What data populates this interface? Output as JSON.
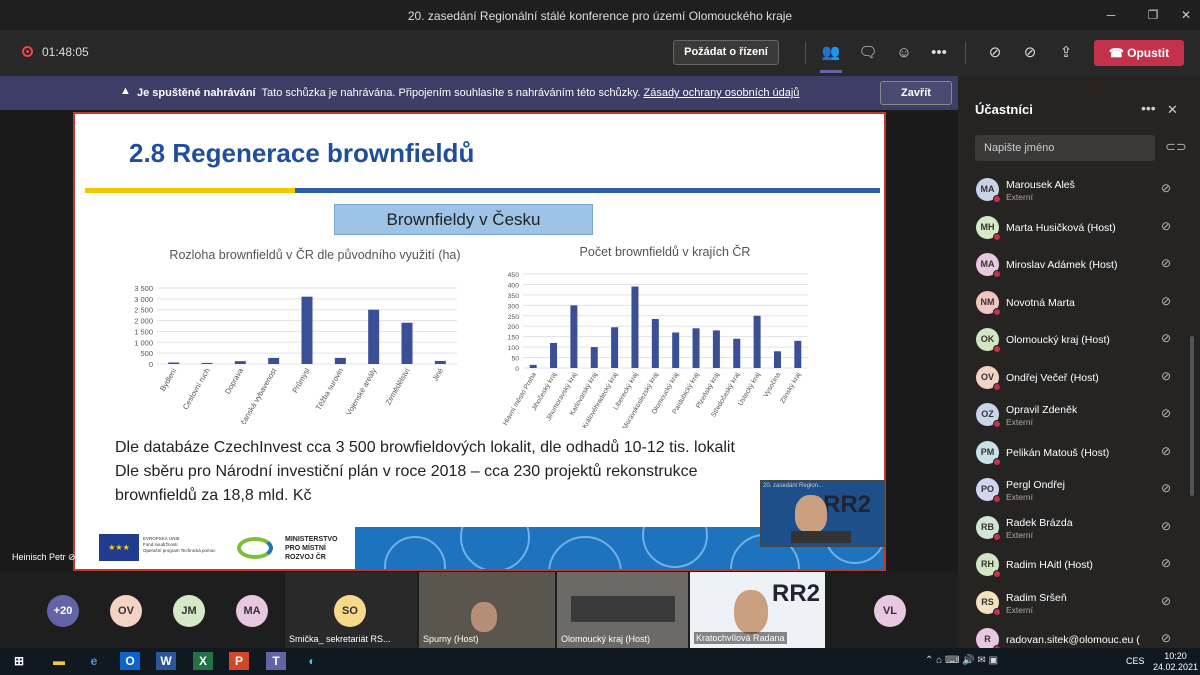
{
  "window": {
    "title": "20. zasedání Regionální stálé konference pro území Olomouckého kraje"
  },
  "toolbar": {
    "timer": "01:48:05",
    "control_label": "Požádat o řízení",
    "leave_label": "Opustit"
  },
  "banner": {
    "strong": "Je spuštěné nahrávání",
    "text": "Tato schůzka je nahrávána. Připojením souhlasíte s nahráváním této schůzky.",
    "link": "Zásady ochrany osobních údajů",
    "dismiss": "Zavřít"
  },
  "slide": {
    "title": "2.8  Regenerace brownfieldů",
    "subhead": "Brownfieldy v Česku",
    "body": [
      "Dle databáze CzechInvest cca 3 500 browfieldových lokalit, dle odhadů 10-12 tis. lokalit",
      "Dle sběru pro Národní investiční plán v roce 2018 – cca 230 projektů rekonstrukce",
      "brownfieldů za 18,8 mld. Kč"
    ],
    "footer": {
      "eu": [
        "EVROPSKÁ UNIE",
        "Fond soudržnosti",
        "Operační program Technická pomoc"
      ],
      "mmr": [
        "MINISTERSTVO",
        "PRO MÍSTNÍ",
        "ROZVOJ ČR"
      ]
    }
  },
  "chart_data": [
    {
      "type": "bar",
      "title": "Rozloha brownfieldů v ČR dle původního využití (ha)",
      "categories": [
        "Bydlení",
        "Cestovní ruch",
        "Doprava",
        "Občanská vybavenost",
        "Průmysl",
        "Těžba surovin",
        "Vojenské areály",
        "Zemědělství",
        "Jiné"
      ],
      "values": [
        70,
        50,
        130,
        280,
        3100,
        280,
        2500,
        1900,
        140
      ],
      "yticks": [
        "3 500",
        "3 000",
        "2 500",
        "2 000",
        "1 500",
        "1 000",
        "500",
        "0"
      ],
      "ylim": [
        0,
        3500
      ],
      "color": "#3a4f96"
    },
    {
      "type": "bar",
      "title": "Počet brownfieldů v krajích ČR",
      "categories": [
        "Hlavní město Praha",
        "Jihočeský kraj",
        "Jihomoravský kraj",
        "Karlovarský kraj",
        "Královéhradecký kraj",
        "Liberecký kraj",
        "Moravskoslezský kraj",
        "Olomoucký kraj",
        "Pardubický kraj",
        "Plzeňský kraj",
        "Středočeský kraj",
        "Ústecký kraj",
        "Vysočina",
        "Zlínský kraj"
      ],
      "values": [
        15,
        120,
        300,
        100,
        195,
        390,
        235,
        170,
        190,
        180,
        140,
        250,
        80,
        130
      ],
      "yticks": [
        "450",
        "400",
        "350",
        "300",
        "250",
        "200",
        "150",
        "100",
        "50",
        "0"
      ],
      "ylim": [
        0,
        450
      ],
      "color": "#3a4f96"
    }
  ],
  "presenter": {
    "name": "Heinisch Petr",
    "pip_header": "20. zasedání Region..."
  },
  "participants": {
    "title": "Účastníci",
    "search_placeholder": "Napište jméno",
    "items": [
      {
        "initials": "MA",
        "name": "Marousek Aleš",
        "role": "Externí",
        "bg": "#c8d3e8"
      },
      {
        "initials": "MH",
        "name": "Marta Husičková (Host)",
        "role": "",
        "bg": "#d6e9c6"
      },
      {
        "initials": "MA",
        "name": "Miroslav Adámek (Host)",
        "role": "",
        "bg": "#e8c8e0"
      },
      {
        "initials": "NM",
        "name": "Novotná Marta",
        "role": "",
        "bg": "#f2c6c0"
      },
      {
        "initials": "OK",
        "name": "Olomoucký kraj (Host)",
        "role": "",
        "bg": "#d3e6c3"
      },
      {
        "initials": "OV",
        "name": "Ondřej Večeř (Host)",
        "role": "",
        "bg": "#f3d3c3"
      },
      {
        "initials": "OZ",
        "name": "Opravil Zdeněk",
        "role": "Externí",
        "bg": "#c8d6e8"
      },
      {
        "initials": "PM",
        "name": "Pelikán Matouš (Host)",
        "role": "",
        "bg": "#c8e3e8"
      },
      {
        "initials": "PO",
        "name": "Pergl Ondřej",
        "role": "Externí",
        "bg": "#cfd6f0"
      },
      {
        "initials": "RB",
        "name": "Radek Brázda",
        "role": "Externí",
        "bg": "#cfe6d3"
      },
      {
        "initials": "RH",
        "name": "Radim HAitl (Host)",
        "role": "",
        "bg": "#d3e6c3"
      },
      {
        "initials": "RS",
        "name": "Radim Sršeň",
        "role": "Externí",
        "bg": "#f3e2c0"
      },
      {
        "initials": "R",
        "name": "radovan.sitek@olomouc.eu (",
        "role": "",
        "bg": "#e8c8e0"
      }
    ]
  },
  "strip": {
    "avatars": [
      {
        "label": "+20",
        "bg": "#6264a7",
        "fg": "#fff"
      },
      {
        "label": "OV",
        "bg": "#f3d3c3",
        "fg": "#333"
      },
      {
        "label": "JM",
        "bg": "#d6e9c6",
        "fg": "#333"
      },
      {
        "label": "MA",
        "bg": "#e8c8e0",
        "fg": "#333"
      }
    ],
    "so": {
      "label": "SO",
      "bg": "#f6d98b",
      "name": "Smička_ sekretariát RS..."
    },
    "tiles": [
      "Spurny (Host)",
      "Olomoucký kraj (Host)",
      "Kratochvílová Radana"
    ],
    "vl": {
      "label": "VL",
      "bg": "#e8c8e0"
    }
  },
  "taskbar": {
    "time": "10:20",
    "date": "24.02.2021",
    "lang": "CES"
  }
}
